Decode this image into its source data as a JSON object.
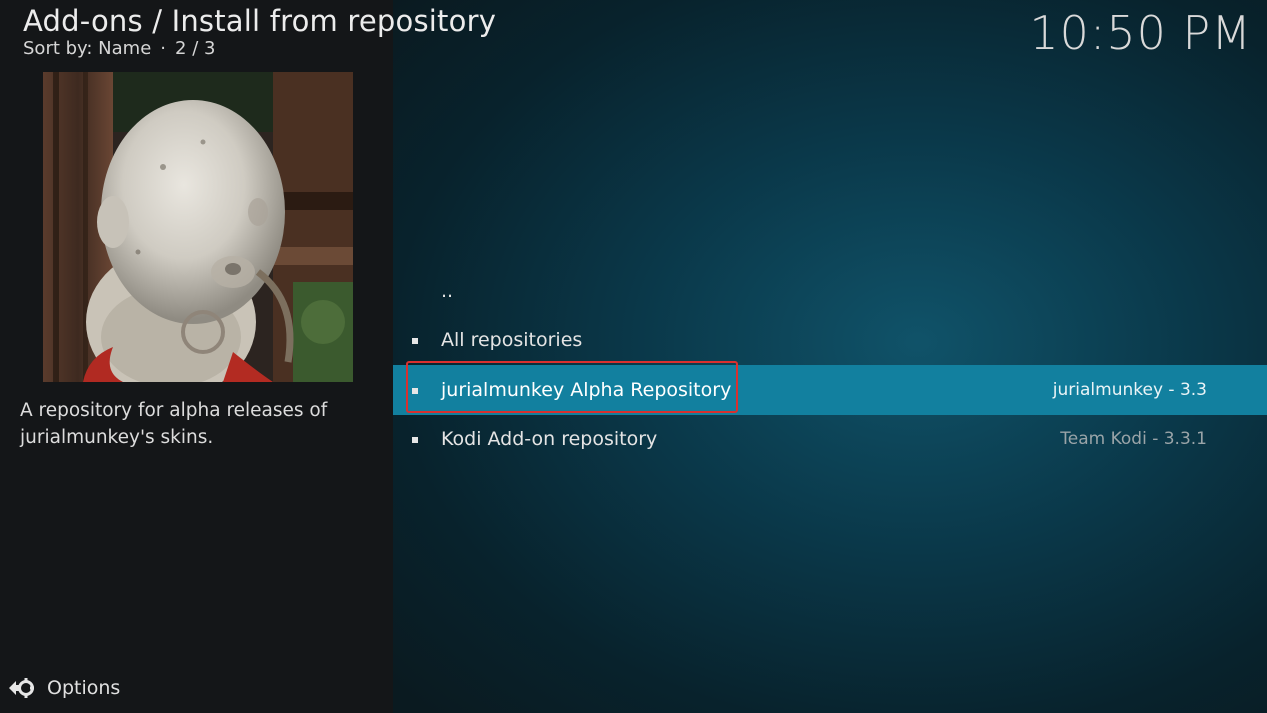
{
  "header": {
    "title": "Add-ons / Install from repository",
    "sort_label": "Sort by: Name",
    "separator": "·",
    "page_counter": "2 / 3",
    "clock": "10:50 PM"
  },
  "info_panel": {
    "thumbnail_icon": "repository-thumbnail",
    "description": "A repository for alpha releases of jurialmunkey's skins."
  },
  "list": {
    "items": [
      {
        "label": "..",
        "meta": "",
        "bullet": false,
        "selected": false
      },
      {
        "label": "All repositories",
        "meta": "",
        "bullet": true,
        "selected": false
      },
      {
        "label": "jurialmunkey Alpha Repository",
        "meta": "jurialmunkey - 3.3",
        "bullet": true,
        "selected": true
      },
      {
        "label": "Kodi Add-on repository",
        "meta": "Team Kodi - 3.3.1",
        "bullet": true,
        "selected": false
      }
    ]
  },
  "footer": {
    "options_label": "Options",
    "options_icon": "options-icon"
  },
  "colors": {
    "selection": "#12809f",
    "highlight_border": "#d9302f",
    "left_panel": "#141618",
    "right_panel_accent": "#10556c"
  }
}
